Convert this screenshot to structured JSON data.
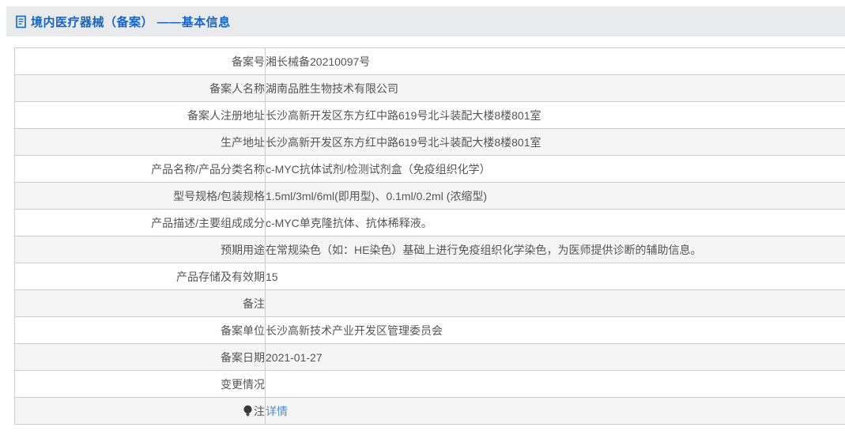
{
  "header": {
    "title": "境内医疗器械（备案） ——基本信息",
    "icon": "document-icon",
    "bar_color": "#e9eaeb",
    "title_color": "#1665c0"
  },
  "colors": {
    "accent_blue": "#1665c0",
    "link_blue": "#4a90d9",
    "row_stripe": "#f5f5f5",
    "border": "#cccccc",
    "text": "#555555"
  },
  "table": {
    "rows": [
      {
        "label": "备案号",
        "value": "湘长械备20210097号"
      },
      {
        "label": "备案人名称",
        "value": "湖南品胜生物技术有限公司"
      },
      {
        "label": "备案人注册地址",
        "value": "长沙高新开发区东方红中路619号北斗装配大楼8楼801室"
      },
      {
        "label": "生产地址",
        "value": "长沙高新开发区东方红中路619号北斗装配大楼8楼801室"
      },
      {
        "label": "产品名称/产品分类名称",
        "value": "c-MYC抗体试剂/检测试剂盒（免疫组织化学）"
      },
      {
        "label": "型号规格/包装规格",
        "value": "1.5ml/3ml/6ml(即用型)、0.1ml/0.2ml (浓缩型)"
      },
      {
        "label": "产品描述/主要组成成分",
        "value": "c-MYC单克隆抗体、抗体稀释液。"
      },
      {
        "label": "预期用途",
        "value": "在常规染色（如：HE染色）基础上进行免疫组织化学染色，为医师提供诊断的辅助信息。"
      },
      {
        "label": "产品存储及有效期",
        "value": "15"
      },
      {
        "label": "备注",
        "value": ""
      },
      {
        "label": "备案单位",
        "value": "长沙高新技术产业开发区管理委员会"
      },
      {
        "label": "备案日期",
        "value": "2021-01-27"
      },
      {
        "label": "变更情况",
        "value": ""
      },
      {
        "label": "注",
        "label_icon": "bulb-icon",
        "value": "详情",
        "value_is_link": true
      }
    ]
  }
}
